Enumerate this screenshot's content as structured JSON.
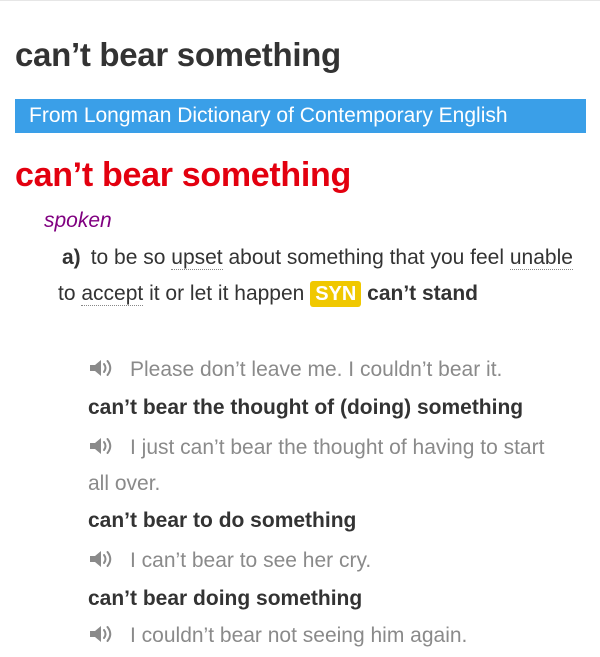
{
  "page": {
    "title": "can’t bear something",
    "source": "From Longman Dictionary of Contemporary English"
  },
  "entry": {
    "headword": "can’t bear something",
    "register": "spoken",
    "sense": {
      "label": "a)",
      "def_part1": "to be so",
      "def_link1": "upset",
      "def_part2": "about something that you feel",
      "def_link2": "unable",
      "def_part3": "to",
      "def_link3": "accept",
      "def_part4": "it or let it happen",
      "syn_badge": "SYN",
      "syn_word": "can’t stand"
    },
    "examples": [
      {
        "icon": "speaker-icon",
        "text": "Please don’t leave me. I couldn’t bear it."
      },
      {
        "icon": "speaker-icon",
        "text": "I just can’t bear the thought of having to start all over."
      },
      {
        "icon": "speaker-icon",
        "text": "I can’t bear to see her cry."
      },
      {
        "icon": "speaker-icon",
        "text": "I couldn’t bear not seeing him again."
      }
    ],
    "collocations": [
      "can’t bear the thought of (doing) something",
      "can’t bear to do something",
      "can’t bear doing something"
    ]
  },
  "colors": {
    "headword": "#e3000f",
    "source_bar": "#3a9fe8",
    "register": "#800080",
    "syn_badge": "#f0c800",
    "example_text": "#8a8a8a"
  }
}
